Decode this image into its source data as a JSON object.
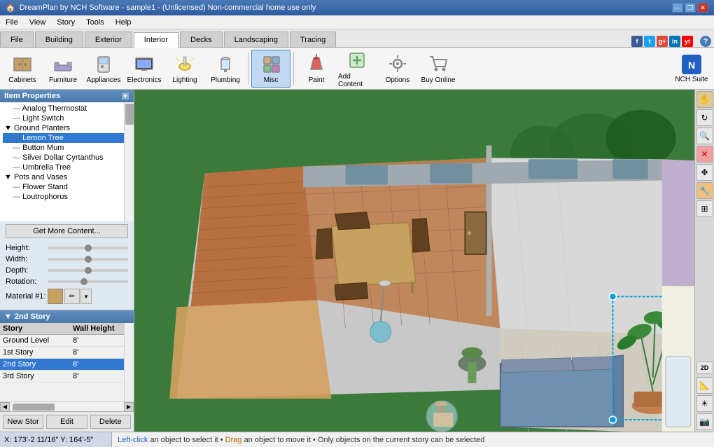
{
  "titlebar": {
    "title": "DreamPlan by NCH Software - sample1 - (Unlicensed) Non-commercial home use only",
    "icon": "🏠",
    "buttons": [
      "—",
      "❐",
      "✕"
    ]
  },
  "menubar": {
    "items": [
      "File",
      "View",
      "Story",
      "Tools",
      "Help"
    ]
  },
  "tabs": {
    "items": [
      "File",
      "Building",
      "Exterior",
      "Interior",
      "Decks",
      "Landscaping",
      "Tracing"
    ],
    "active": "Interior"
  },
  "toolbar": {
    "items": [
      {
        "id": "cabinets",
        "label": "Cabinets",
        "icon": "🗄"
      },
      {
        "id": "furniture",
        "label": "Furniture",
        "icon": "🛋"
      },
      {
        "id": "appliances",
        "label": "Appliances",
        "icon": "🔌"
      },
      {
        "id": "electronics",
        "label": "Electronics",
        "icon": "📺"
      },
      {
        "id": "lighting",
        "label": "Lighting",
        "icon": "💡"
      },
      {
        "id": "plumbing",
        "label": "Plumbing",
        "icon": "🚿"
      },
      {
        "id": "misc",
        "label": "Misc",
        "icon": "📦",
        "active": true
      },
      {
        "id": "paint",
        "label": "Paint",
        "icon": "🎨"
      },
      {
        "id": "add-content",
        "label": "Add Content",
        "icon": "➕"
      },
      {
        "id": "options",
        "label": "Options",
        "icon": "⚙"
      },
      {
        "id": "buy-online",
        "label": "Buy Online",
        "icon": "🛒"
      }
    ],
    "nch_label": "NCH Suite"
  },
  "item_properties": {
    "title": "Item Properties",
    "tree": [
      {
        "type": "item",
        "label": "Analog Thermostat",
        "indent": 1
      },
      {
        "type": "item",
        "label": "Light Switch",
        "indent": 1
      },
      {
        "type": "group",
        "label": "Ground Planters",
        "indent": 0
      },
      {
        "type": "item",
        "label": "Lemon Tree",
        "indent": 2,
        "selected": true
      },
      {
        "type": "item",
        "label": "Button Mum",
        "indent": 2
      },
      {
        "type": "item",
        "label": "Silver Dollar Cyrtanthus",
        "indent": 2
      },
      {
        "type": "item",
        "label": "Umbrella Tree",
        "indent": 2
      },
      {
        "type": "group",
        "label": "Pots and Vases",
        "indent": 0
      },
      {
        "type": "item",
        "label": "Flower Stand",
        "indent": 2
      },
      {
        "type": "item",
        "label": "Loutrophorus",
        "indent": 2
      }
    ],
    "get_more_btn": "Get More Content...",
    "fields": [
      {
        "label": "Height:",
        "thumb_pos": "50%"
      },
      {
        "label": "Width:",
        "thumb_pos": "50%"
      },
      {
        "label": "Depth:",
        "thumb_pos": "50%"
      },
      {
        "label": "Rotation:",
        "thumb_pos": "45%"
      }
    ],
    "material_label": "Material #1:"
  },
  "stories": {
    "title": "2nd Story",
    "columns": [
      "Story",
      "Wall Height"
    ],
    "rows": [
      {
        "story": "Ground Level",
        "height": "8'",
        "active": false
      },
      {
        "story": "1st Story",
        "height": "8'",
        "active": false
      },
      {
        "story": "2nd Story",
        "height": "8'",
        "active": true
      },
      {
        "story": "3rd Story",
        "height": "8'",
        "active": false
      }
    ],
    "buttons": [
      "New Stor",
      "Edit",
      "Delete"
    ]
  },
  "statusbar": {
    "coords": "X: 173'-2 11/16\"  Y: 164'-5\"",
    "message": "Left-click an object to select it • Drag an object to move it • Only objects on the current story can be selected"
  },
  "social": {
    "buttons": [
      {
        "label": "f",
        "color": "#3b5998"
      },
      {
        "label": "t",
        "color": "#1da1f2"
      },
      {
        "label": "g+",
        "color": "#dd4b39"
      },
      {
        "label": "in",
        "color": "#0077b5"
      },
      {
        "label": "yt",
        "color": "#ff0000"
      }
    ]
  }
}
